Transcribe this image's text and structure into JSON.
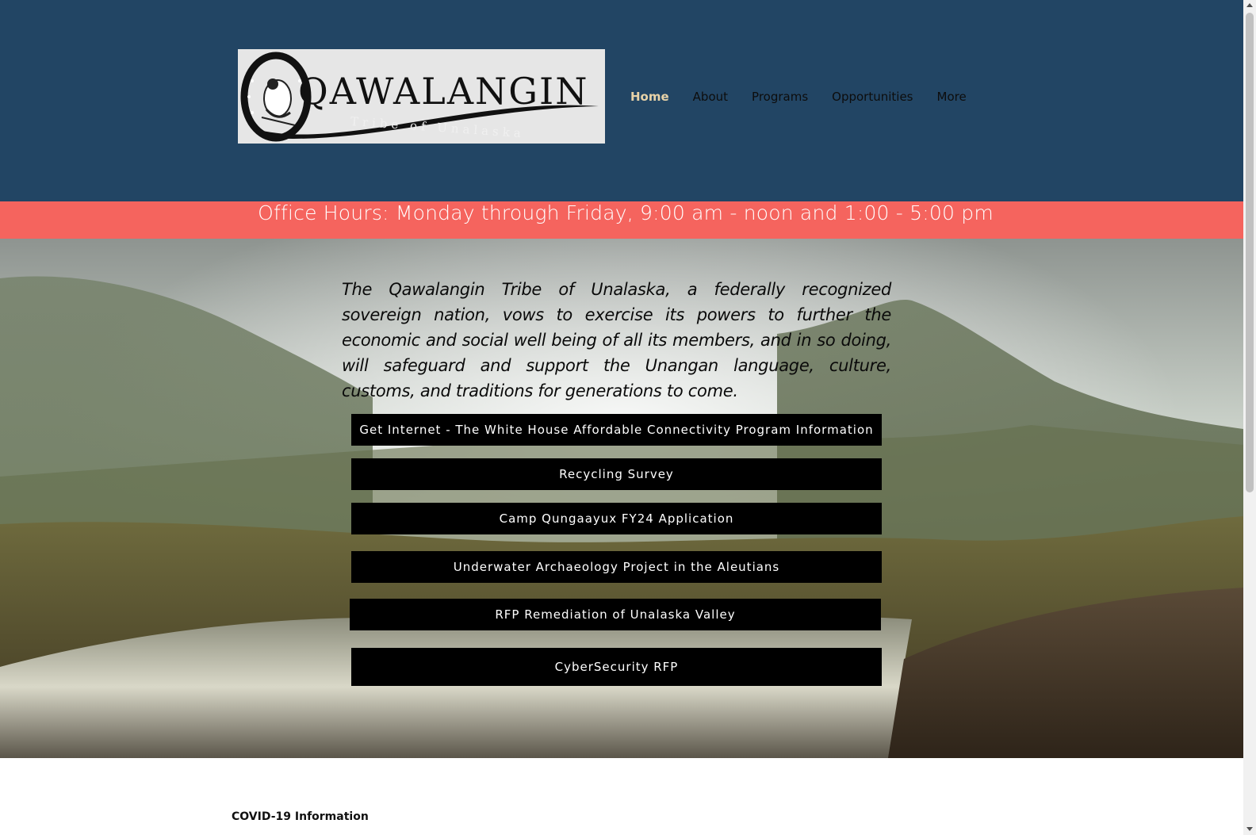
{
  "header": {
    "logo": {
      "main_text": "QAWALANGIN",
      "sub_text": "Tribe of Unalaska"
    },
    "nav": [
      {
        "label": "Home",
        "active": true
      },
      {
        "label": "About",
        "active": false
      },
      {
        "label": "Programs",
        "active": false
      },
      {
        "label": "Opportunities",
        "active": false
      },
      {
        "label": "More",
        "active": false
      }
    ],
    "background_color": "#224564",
    "active_color": "#e8d3a8"
  },
  "office_hours": {
    "text": "Office Hours: Monday through Friday, 9:00 am - noon and 1:00 - 5:00 pm",
    "background_color": "#f5645e"
  },
  "hero": {
    "mission": "The Qawalangin Tribe of Unalaska, a federally recognized sovereign nation, vows to exercise its powers to further the economic and social well being of all its members, and in so doing, will safeguard and support the Unangan language, culture, customs, and traditions for generations to come.",
    "buttons": [
      {
        "label": "Get Internet - The White House Affordable Connectivity Program Information"
      },
      {
        "label": "Recycling Survey"
      },
      {
        "label": "Camp Qungaayux FY24 Application"
      },
      {
        "label": "Underwater Archaeology Project in the Aleutians"
      },
      {
        "label": "RFP Remediation of Unalaska Valley"
      },
      {
        "label": "CyberSecurity RFP"
      }
    ]
  },
  "section": {
    "covid_heading": "COVID-19 Information"
  }
}
